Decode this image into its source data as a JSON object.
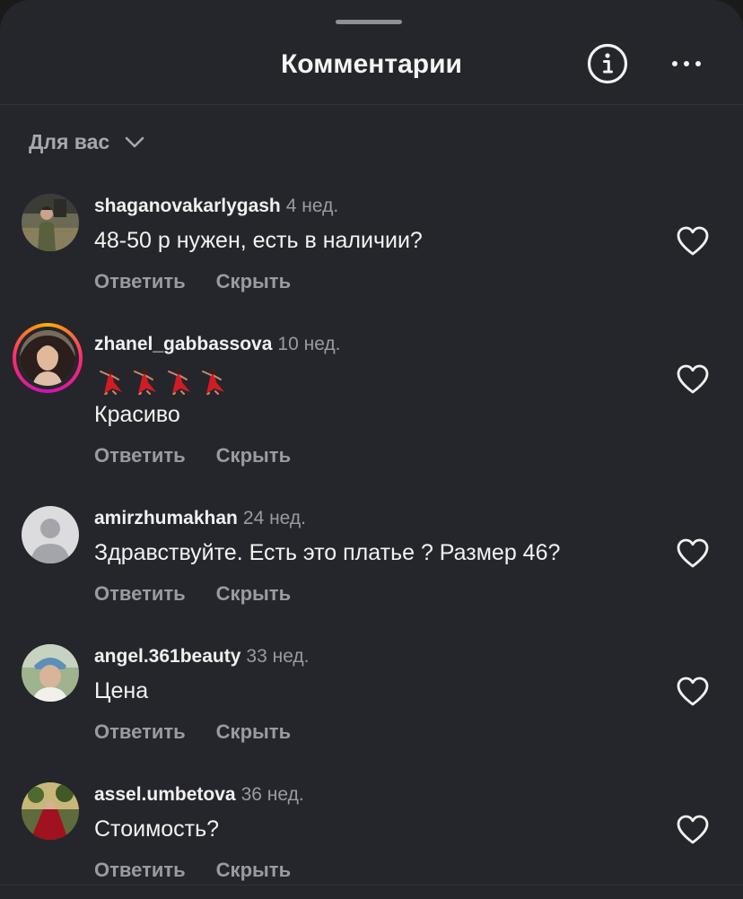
{
  "header": {
    "title": "Комментарии",
    "info_icon": "info-circle-icon",
    "more_icon": "more-horizontal-icon"
  },
  "filter": {
    "label": "Для вас",
    "icon": "chevron-down-icon"
  },
  "colors": {
    "sheet_background": "#25262b",
    "primary_text": "#f2f2f2",
    "secondary_text": "#9a9ba0",
    "story_ring": "#ff2a6d"
  },
  "comments": [
    {
      "username": "shaganovakarlygash",
      "time": "4 нед.",
      "text": "48-50 р нужен, есть в наличии?",
      "reply_label": "Ответить",
      "hide_label": "Скрыть",
      "avatar": "photo-avatar"
    },
    {
      "username": "zhanel_gabbassova",
      "time": "10 нед.",
      "emoji": [
        "💃",
        "💃",
        "💃",
        "💃"
      ],
      "text": "Красиво",
      "reply_label": "Ответить",
      "hide_label": "Скрыть",
      "avatar": "story-ring-avatar"
    },
    {
      "username": "amirzhumakhan",
      "time": "24 нед.",
      "text": "Здравствуйте. Есть это платье ? Размер 46?",
      "reply_label": "Ответить",
      "hide_label": "Скрыть",
      "avatar": "default-avatar"
    },
    {
      "username": "angel.361beauty",
      "time": "33 нед.",
      "text": "Цена",
      "reply_label": "Ответить",
      "hide_label": "Скрыть",
      "avatar": "photo-avatar"
    },
    {
      "username": "assel.umbetova",
      "time": "36 нед.",
      "text": "Стоимость?",
      "reply_label": "Ответить",
      "hide_label": "Скрыть",
      "avatar": "photo-avatar"
    }
  ]
}
